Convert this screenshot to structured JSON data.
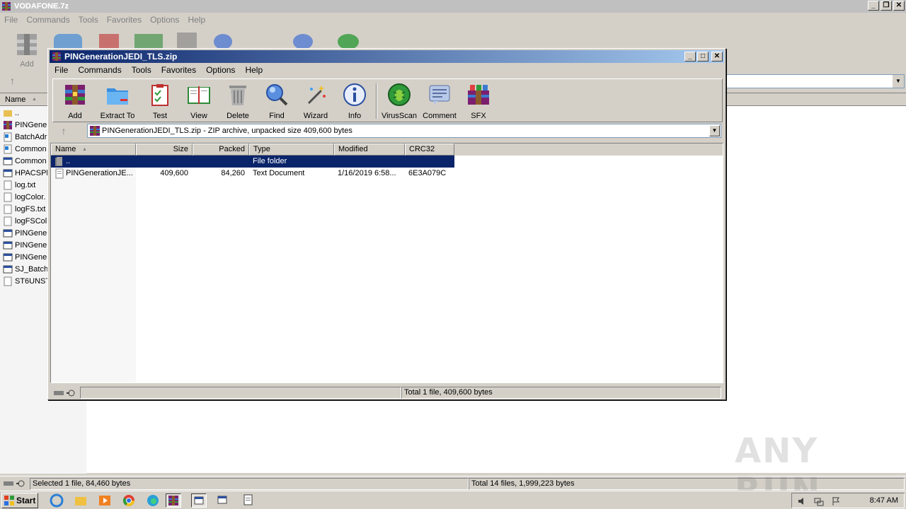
{
  "background_window": {
    "title": "VODAFONE.7z",
    "menu": [
      "File",
      "Commands",
      "Tools",
      "Favorites",
      "Options",
      "Help"
    ],
    "toolbar_first_label": "Add",
    "list_header_name": "Name",
    "files": [
      "..",
      "PINGene",
      "BatchAdr",
      "Common",
      "Common",
      "HPACSPb",
      "log.txt",
      "logColor.",
      "logFS.txt",
      "logFSCol",
      "PINGene",
      "PINGene",
      "PINGene",
      "SJ_Batch",
      "ST6UNST"
    ],
    "status_left": "Selected 1 file, 84,460 bytes",
    "status_right": "Total 14 files, 1,999,223 bytes"
  },
  "foreground_window": {
    "title": "PINGenerationJEDI_TLS.zip",
    "menu": [
      "File",
      "Commands",
      "Tools",
      "Favorites",
      "Options",
      "Help"
    ],
    "toolbar": [
      {
        "label": "Add",
        "icon": "add-archive-icon"
      },
      {
        "label": "Extract To",
        "icon": "extract-folder-icon"
      },
      {
        "label": "Test",
        "icon": "test-clipboard-icon"
      },
      {
        "label": "View",
        "icon": "view-book-icon"
      },
      {
        "label": "Delete",
        "icon": "trash-can-icon"
      },
      {
        "label": "Find",
        "icon": "magnifier-icon"
      },
      {
        "label": "Wizard",
        "icon": "magic-wand-icon"
      },
      {
        "label": "Info",
        "icon": "info-icon"
      },
      {
        "label": "VirusScan",
        "icon": "virus-scan-icon"
      },
      {
        "label": "Comment",
        "icon": "comment-icon"
      },
      {
        "label": "SFX",
        "icon": "sfx-icon"
      }
    ],
    "address": "PINGenerationJEDI_TLS.zip - ZIP archive, unpacked size 409,600 bytes",
    "columns": [
      "Name",
      "Size",
      "Packed",
      "Type",
      "Modified",
      "CRC32"
    ],
    "rows": [
      {
        "name": "..",
        "size": "",
        "packed": "",
        "type": "File folder",
        "modified": "",
        "crc": "",
        "selected": true
      },
      {
        "name": "PINGenerationJE...",
        "size": "409,600",
        "packed": "84,260",
        "type": "Text Document",
        "modified": "1/16/2019 6:58...",
        "crc": "6E3A079C",
        "selected": false
      }
    ],
    "status": "Total 1 file, 409,600 bytes"
  },
  "watermark": "ANY RUN",
  "taskbar": {
    "start_label": "Start",
    "clock": "8:47 AM"
  },
  "colors": {
    "title_active": "#0a246a",
    "selection": "#0a246a",
    "face": "#d4d0c8"
  }
}
